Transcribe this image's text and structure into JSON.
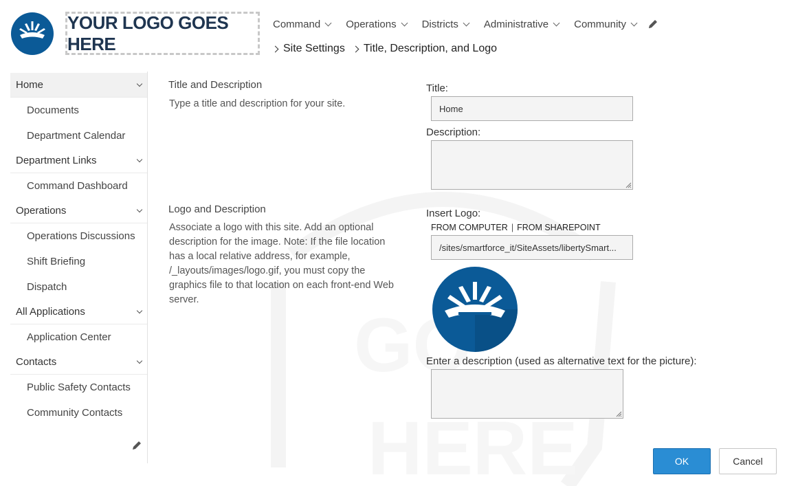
{
  "header": {
    "logo_placeholder_text": "YOUR LOGO GOES HERE",
    "brand_color": "#0b5a97"
  },
  "topnav": {
    "items": [
      {
        "label": "Command"
      },
      {
        "label": "Operations"
      },
      {
        "label": "Districts"
      },
      {
        "label": "Administrative"
      },
      {
        "label": "Community"
      }
    ],
    "edit_icon": "pencil-icon"
  },
  "breadcrumb": {
    "items": [
      {
        "label": "Site Settings"
      },
      {
        "label": "Title, Description, and Logo"
      }
    ]
  },
  "leftnav": {
    "sections": [
      {
        "label": "Home",
        "items": [
          "Documents",
          "Department Calendar"
        ]
      },
      {
        "label": "Department Links",
        "items": [
          "Command Dashboard"
        ]
      },
      {
        "label": "Operations",
        "items": [
          "Operations Discussions",
          "Shift Briefing",
          "Dispatch"
        ]
      },
      {
        "label": "All Applications",
        "items": [
          "Application Center"
        ]
      },
      {
        "label": "Contacts",
        "items": [
          "Public Safety Contacts",
          "Community Contacts"
        ]
      }
    ]
  },
  "form": {
    "title_section": {
      "heading": "Title and Description",
      "description": "Type a title and description for your site."
    },
    "title_label": "Title:",
    "title_value": "Home",
    "description_label": "Description:",
    "logo_section": {
      "heading": "Logo and Description",
      "description": "Associate a logo with this site. Add an optional description for the image. Note: If the file location has a local relative address, for example, /_layouts/images/logo.gif, you must copy the graphics file to that location on each front-end Web server."
    },
    "insert_logo_label": "Insert Logo:",
    "from_computer": "FROM COMPUTER",
    "link_separator": "|",
    "from_sharepoint": "FROM SHAREPOINT",
    "logo_url": "/sites/smartforce_it/SiteAssets/libertySmart...",
    "alt_text_label": "Enter a description (used as alternative text for the picture):"
  },
  "buttons": {
    "ok": "OK",
    "cancel": "Cancel",
    "ok_color": "#2a8dd4"
  }
}
